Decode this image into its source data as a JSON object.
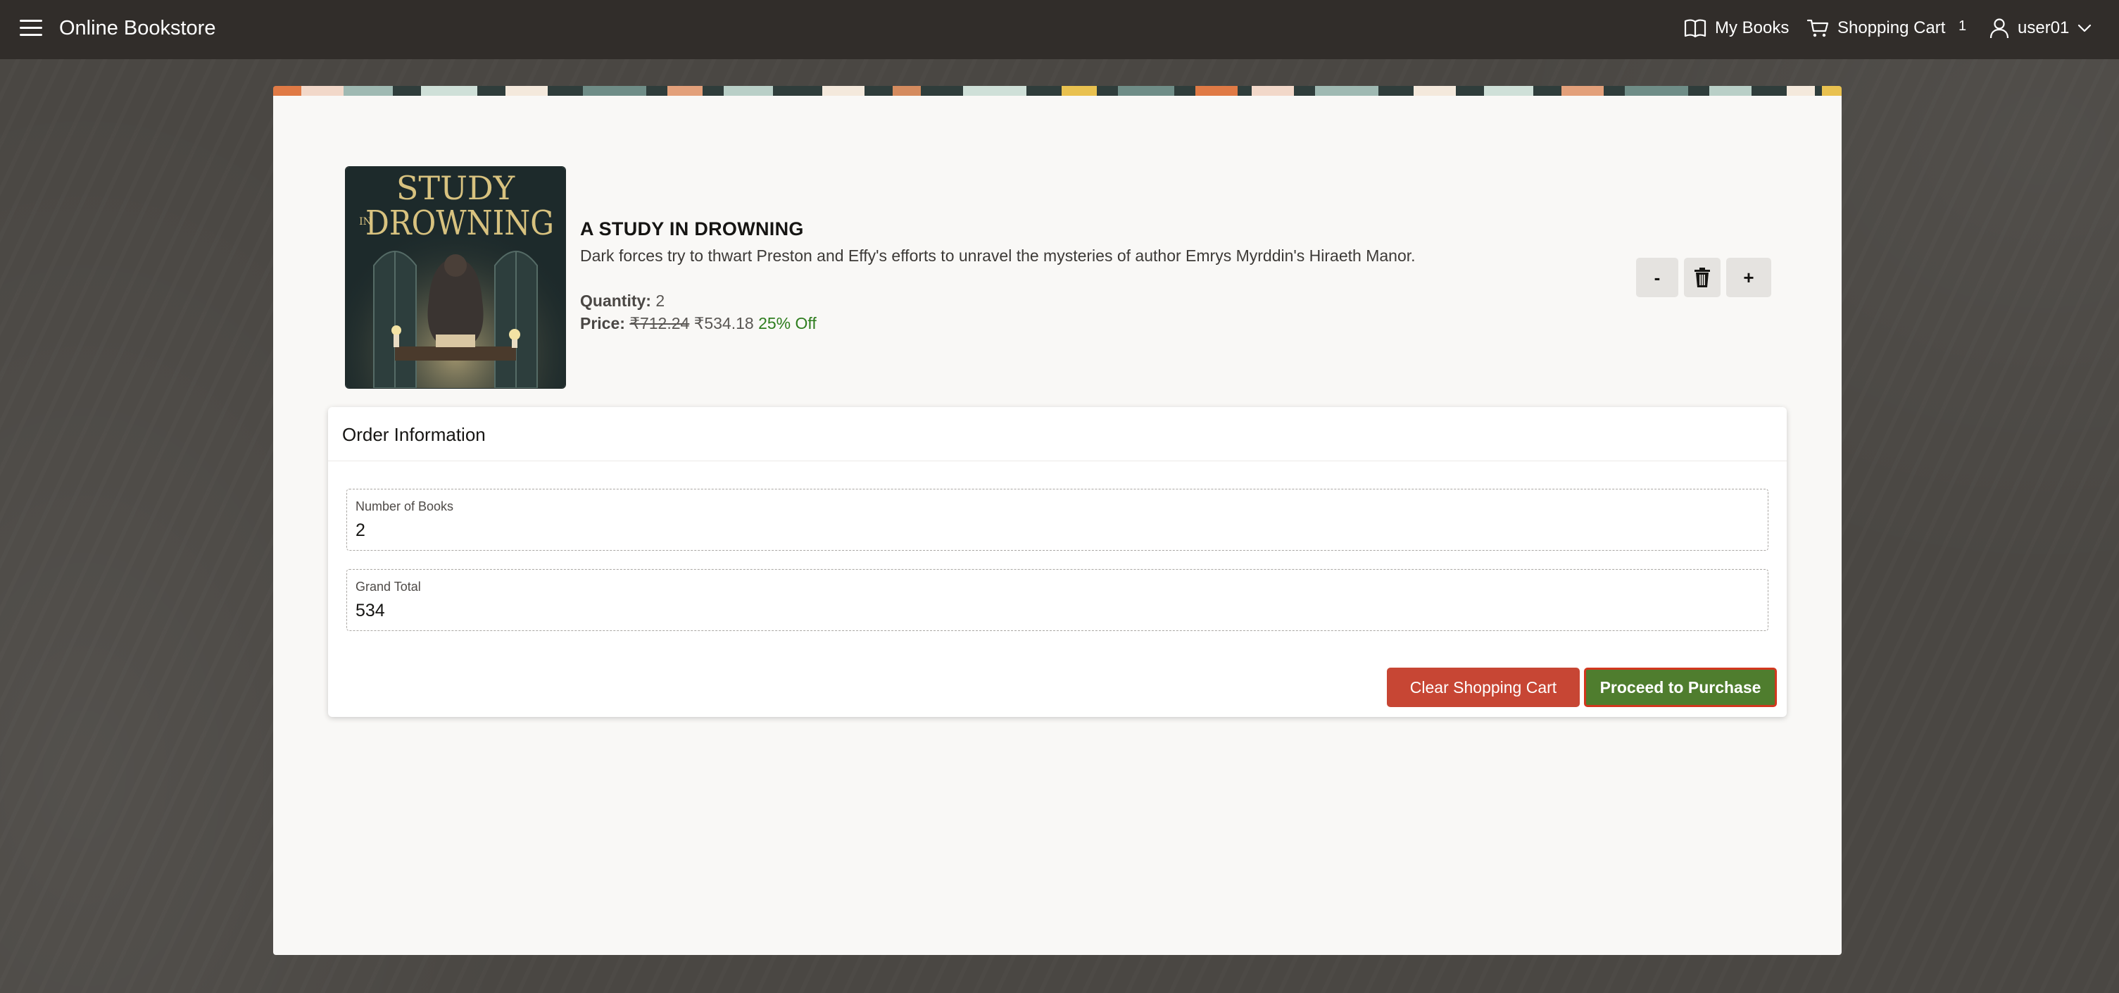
{
  "header": {
    "app_title": "Online Bookstore",
    "menu_icon": "hamburger-menu-icon",
    "my_books_label": "My Books",
    "my_books_icon": "open-book-icon",
    "cart_label": "Shopping Cart",
    "cart_icon": "shopping-cart-icon",
    "cart_count": "1",
    "user_label": "user01",
    "user_icon": "user-icon",
    "user_menu_icon": "chevron-down-icon"
  },
  "cart_item": {
    "cover_title_line1": "STUDY",
    "cover_title_in": "IN",
    "cover_title_line2": "DROWNING",
    "title": "A STUDY IN DROWNING",
    "description": "Dark forces try to thwart Preston and Effy's efforts to unravel the mysteries of author Emrys Myrddin's Hiraeth Manor.",
    "quantity_label": "Quantity:",
    "quantity_value": "2",
    "price_label": "Price:",
    "original_price": "₹712.24",
    "sale_price": "₹534.18",
    "discount": "25% Off",
    "decrement_label": "-",
    "delete_icon": "trash-icon",
    "increment_label": "+"
  },
  "order_info": {
    "title": "Order Information",
    "number_of_books_label": "Number of Books",
    "number_of_books_value": "2",
    "grand_total_label": "Grand Total",
    "grand_total_value": "534",
    "clear_cart_label": "Clear Shopping Cart",
    "proceed_label": "Proceed to Purchase"
  },
  "colors": {
    "header_bg": "#312d2a",
    "page_bg": "#4a4743",
    "card_bg": "#f9f8f6",
    "clear_button": "#c74634",
    "proceed_button": "#4f7d2e",
    "proceed_focus_border": "#d2371e",
    "discount_text": "#2e7d1e"
  }
}
